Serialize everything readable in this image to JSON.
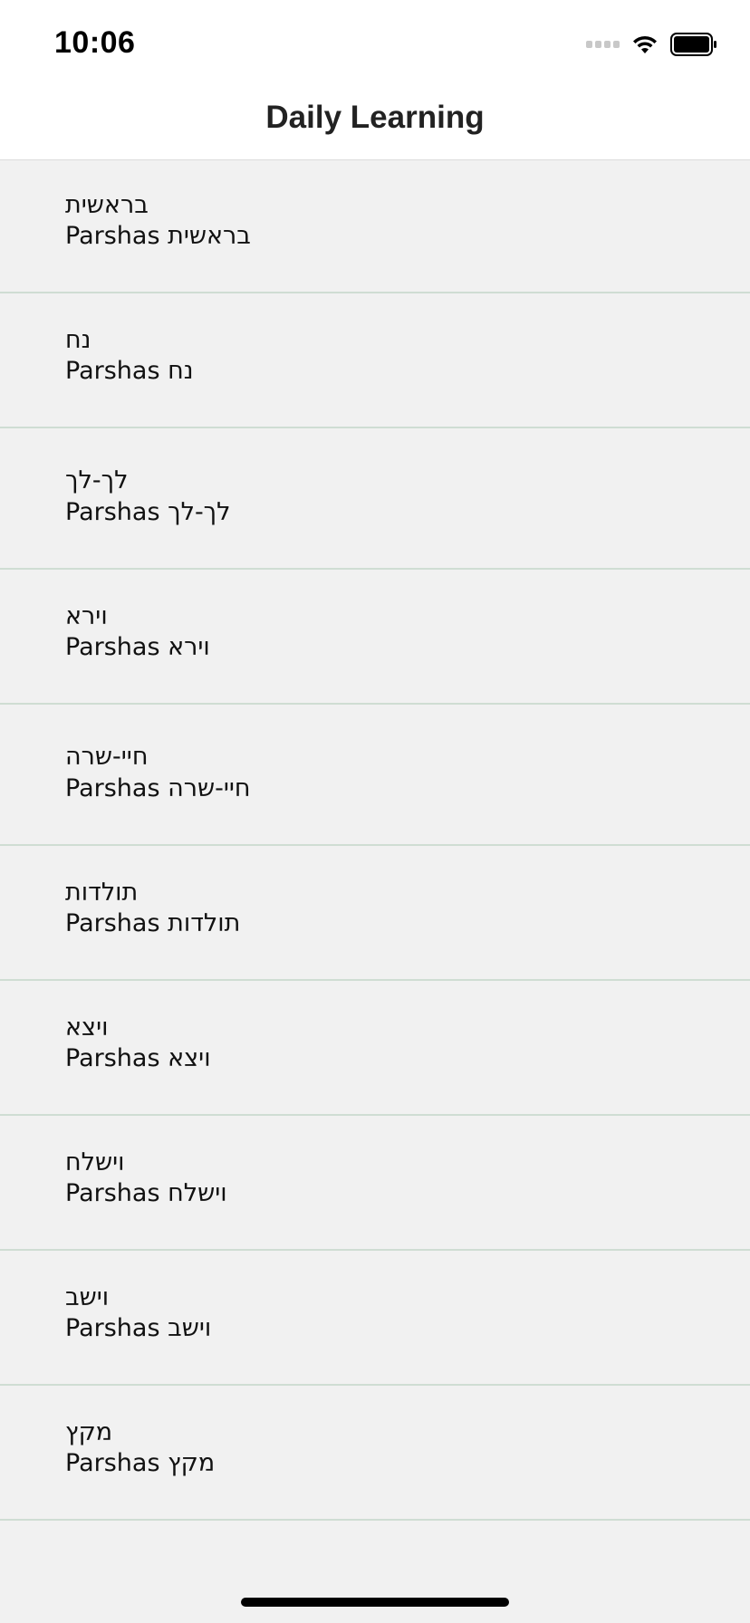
{
  "status_bar": {
    "time": "10:06"
  },
  "nav": {
    "title": "Daily Learning"
  },
  "list": {
    "items": [
      {
        "hebrew": "בראשית",
        "subtitle": "Parshas בראשית"
      },
      {
        "hebrew": "נח",
        "subtitle": "Parshas נח"
      },
      {
        "hebrew": "לך-לך",
        "subtitle": "Parshas לך-לך"
      },
      {
        "hebrew": "וירא",
        "subtitle": "Parshas וירא"
      },
      {
        "hebrew": "חיי-שרה",
        "subtitle": "Parshas חיי-שרה"
      },
      {
        "hebrew": "תולדות",
        "subtitle": "Parshas תולדות"
      },
      {
        "hebrew": "ויצא",
        "subtitle": "Parshas ויצא"
      },
      {
        "hebrew": "וישלח",
        "subtitle": "Parshas וישלח"
      },
      {
        "hebrew": "וישב",
        "subtitle": "Parshas וישב"
      },
      {
        "hebrew": "מקץ",
        "subtitle": "Parshas מקץ"
      }
    ]
  }
}
